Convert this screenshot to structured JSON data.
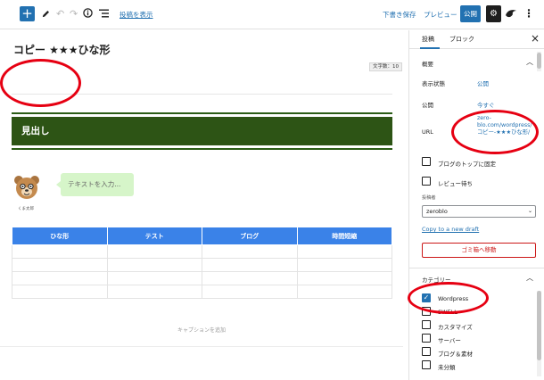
{
  "toolbar": {
    "view_post": "投稿を表示",
    "save_draft": "下書き保存",
    "preview": "プレビュー",
    "publish": "公開"
  },
  "editor": {
    "title": "コピー ★★★ひな形",
    "word_count": "文字数：10",
    "heading": "見出し",
    "avatar_name": "くま太郎",
    "balloon_text": "テキストを入力...",
    "table_headers": [
      "ひな形",
      "テスト",
      "ブログ",
      "時間短縮"
    ],
    "table_rows": 4,
    "caption_placeholder": "キャプションを追加"
  },
  "sidebar": {
    "tabs": [
      "投稿",
      "ブロック"
    ],
    "summary_title": "概要",
    "visibility_label": "表示状態",
    "visibility_value": "公開",
    "publish_label": "公開",
    "publish_value": "今すぐ",
    "url_label": "URL",
    "url_value": "zero-blo.com/wordpress/コピー-★★★ひな形/",
    "stick_to_top": "ブログのトップに固定",
    "pending_review": "レビュー待ち",
    "author_label": "投稿者",
    "author_value": "zeroblo",
    "copy_to_draft": "Copy to a new draft",
    "move_to_trash": "ゴミ箱へ移動",
    "categories_title": "カテゴリー",
    "categories": [
      {
        "label": "Wordpress",
        "checked": true
      },
      {
        "label": "SWELL",
        "checked": false
      },
      {
        "label": "カスタマイズ",
        "checked": false
      },
      {
        "label": "サーバー",
        "checked": false
      },
      {
        "label": "ブログ＆素材",
        "checked": false
      },
      {
        "label": "未分類",
        "checked": false
      }
    ]
  },
  "colors": {
    "accent": "#2271b1",
    "heading_bg": "#2d5415",
    "table_header": "#3a82e8",
    "balloon_bg": "#d6f5c9",
    "annotation": "#e60012",
    "trash": "#cc1818"
  }
}
